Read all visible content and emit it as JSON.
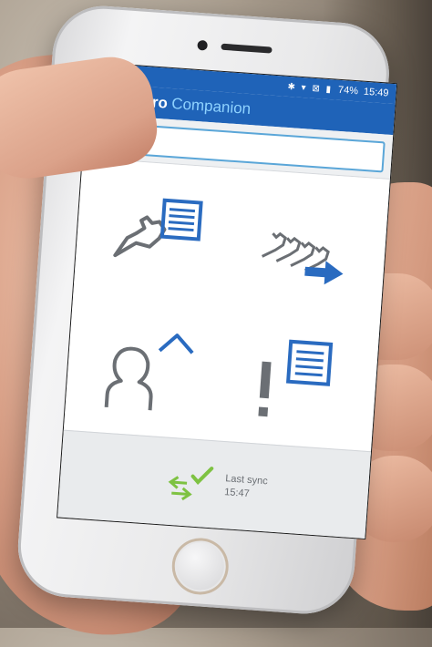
{
  "statusbar": {
    "icons": "✱ ▾ ⊠ ▮",
    "battery": "74%",
    "time": "15:49"
  },
  "appbar": {
    "brand": "DelPro",
    "brand_sub": "Companion"
  },
  "search": {
    "placeholder": ""
  },
  "tiles": [
    {
      "icon": "cow-info-icon"
    },
    {
      "icon": "cows-move-icon"
    },
    {
      "icon": "person-home-icon"
    },
    {
      "icon": "alert-list-icon"
    }
  ],
  "footer": {
    "sync_label": "Last sync",
    "sync_time": "15:47",
    "sync_icon": "sync-arrows-check-icon"
  },
  "colors": {
    "primary": "#1f63b8",
    "accent": "#8fd3ff",
    "icon_blue": "#2a6bc0",
    "icon_gray": "#6b6f74",
    "sync_green": "#7ec242"
  }
}
